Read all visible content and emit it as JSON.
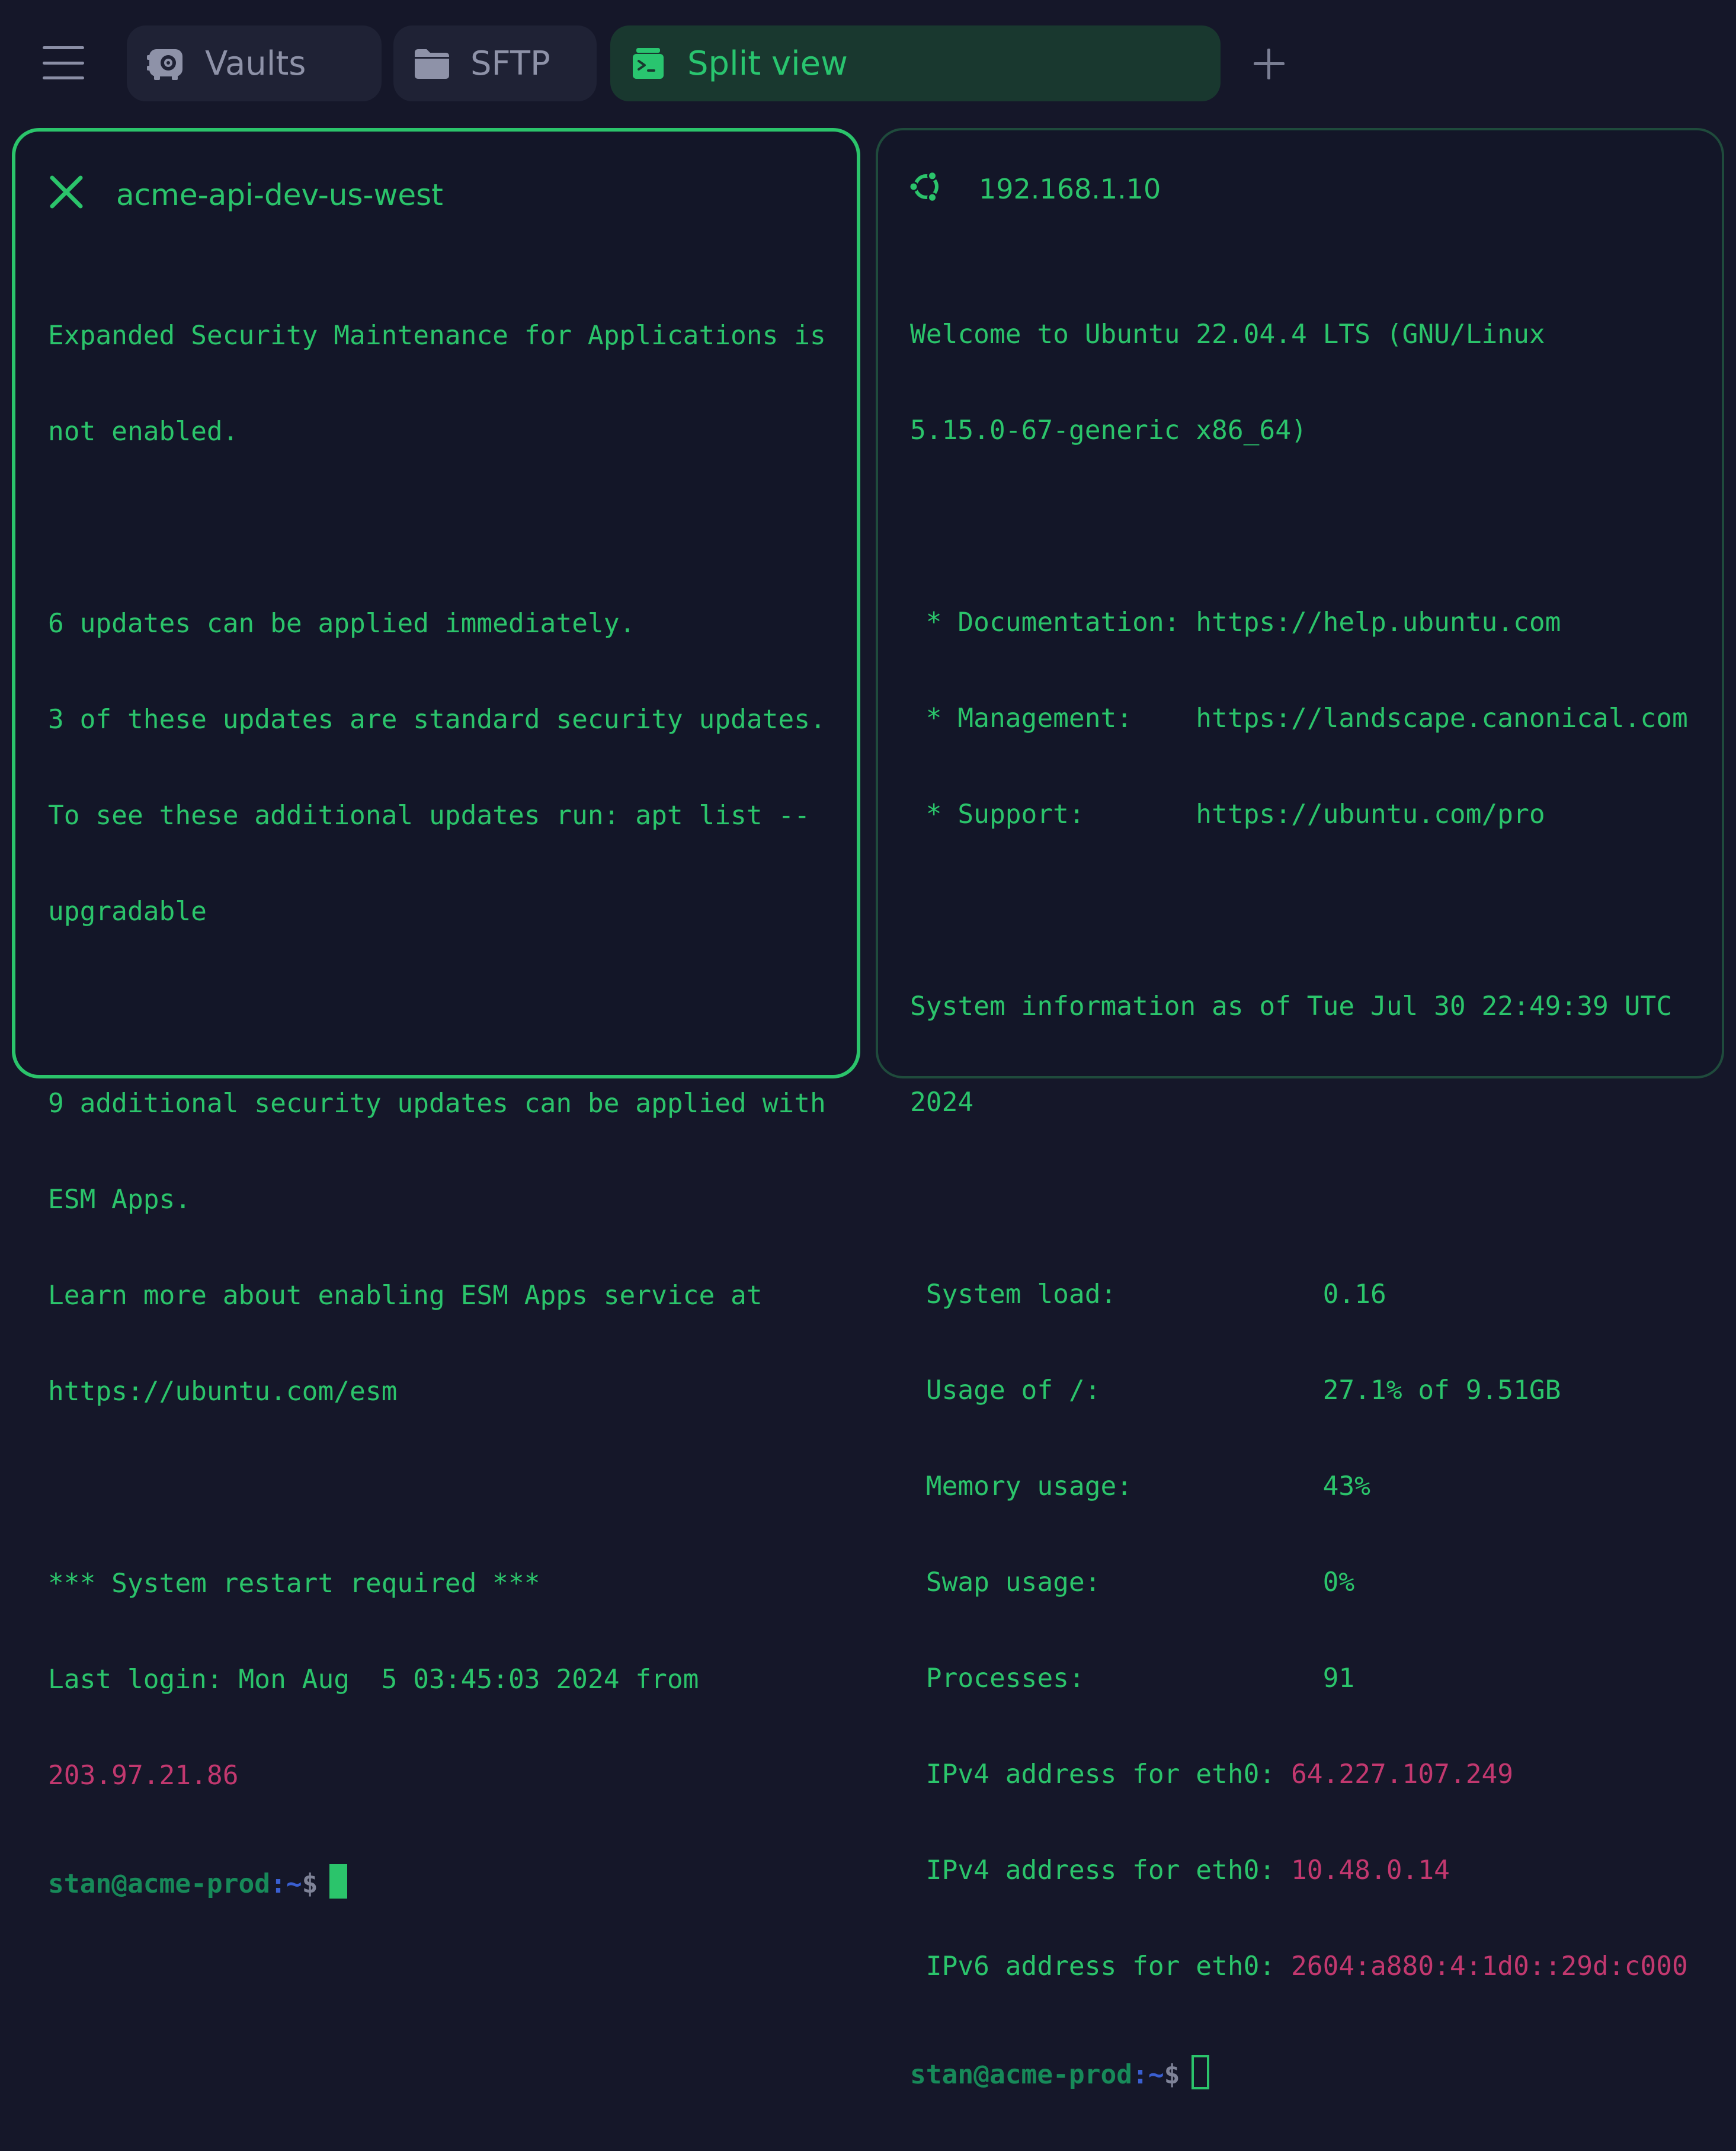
{
  "topbar": {
    "menu_icon": "hamburger-menu-icon",
    "tabs": [
      {
        "label": "Vaults",
        "icon": "vault-icon",
        "active": false
      },
      {
        "label": "SFTP",
        "icon": "folder-icon",
        "active": false
      },
      {
        "label": "Split view",
        "icon": "terminal-icon",
        "active": true
      }
    ],
    "add_tab_icon": "plus-icon"
  },
  "colors": {
    "background": "#151729",
    "accent_green": "#2bc46b",
    "active_tab_bg": "#19382f",
    "inactive_tab_bg": "#1f2235",
    "ip_magenta": "#c2386f",
    "prompt_user": "#178a59",
    "prompt_tilde": "#3a5fd1"
  },
  "left_pane": {
    "title": "acme-api-dev-us-west",
    "header_icon": "close-icon",
    "lines": {
      "l1": "Expanded Security Maintenance for Applications is",
      "l2": "not enabled.",
      "l3": "6 updates can be applied immediately.",
      "l4": "3 of these updates are standard security updates.",
      "l5": "To see these additional updates run: apt list --",
      "l6": "upgradable",
      "l7": "9 additional security updates can be applied with",
      "l8": "ESM Apps.",
      "l9": "Learn more about enabling ESM Apps service at",
      "l10": "https://ubuntu.com/esm",
      "l11": "*** System restart required ***",
      "l12": "Last login: Mon Aug  5 03:45:03 2024 from",
      "l13_ip": "203.97.21.86"
    },
    "prompt": {
      "user": "stan@acme-prod",
      "colon": ":",
      "path": "~",
      "symbol": "$"
    }
  },
  "right_pane": {
    "title": "192.168.1.10",
    "header_icon": "ubuntu-icon",
    "lines": {
      "l1": "Welcome to Ubuntu 22.04.4 LTS (GNU/Linux",
      "l2": "5.15.0-67-generic x86_64)",
      "l3": " * Documentation: https://help.ubuntu.com",
      "l4": " * Management:    https://landscape.canonical.com",
      "l5": " * Support:       https://ubuntu.com/pro",
      "l6": "System information as of Tue Jul 30 22:49:39 UTC",
      "l7": "2024",
      "l8": " System load:             0.16",
      "l9": " Usage of /:              27.1% of 9.51GB",
      "l10": " Memory usage:            43%",
      "l11": " Swap usage:              0%",
      "l12": " Processes:               91",
      "l13_label": " IPv4 address for eth0: ",
      "l13_ip": "64.227.107.249",
      "l14_label": " IPv4 address for eth0: ",
      "l14_ip": "10.48.0.14",
      "l15_label": " IPv6 address for eth0: ",
      "l15_ip": "2604:a880:4:1d0::29d:c000"
    },
    "prompt": {
      "user": "stan@acme-prod",
      "colon": ":",
      "path": "~",
      "symbol": "$"
    }
  }
}
